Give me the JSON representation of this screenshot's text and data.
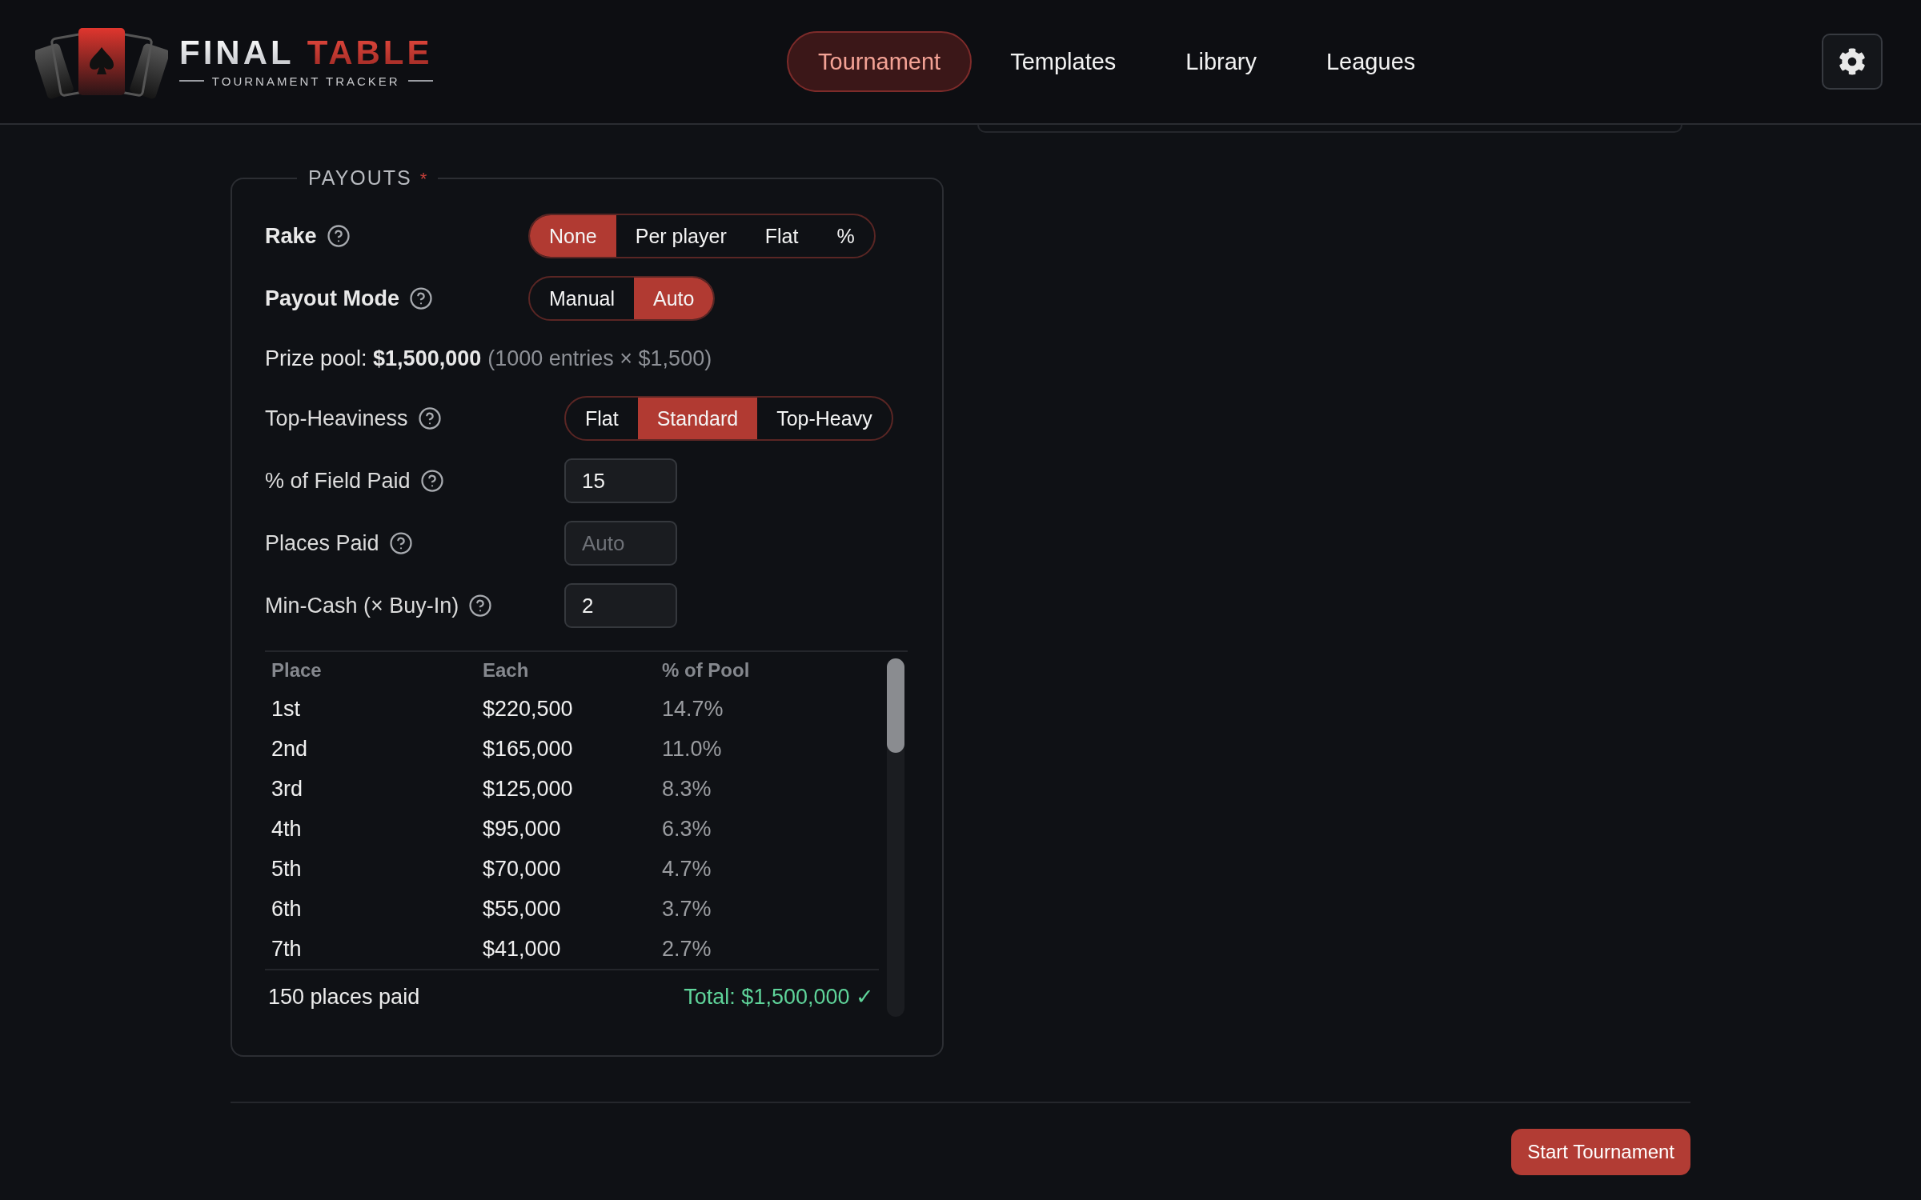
{
  "header": {
    "logo": {
      "title_primary": "FINAL",
      "title_accent": "TABLE",
      "subtitle": "TOURNAMENT TRACKER"
    },
    "nav": [
      {
        "label": "Tournament",
        "selected": true
      },
      {
        "label": "Templates",
        "selected": false
      },
      {
        "label": "Library",
        "selected": false
      },
      {
        "label": "Leagues",
        "selected": false
      }
    ]
  },
  "payouts": {
    "legend": "PAYOUTS",
    "required_mark": "*",
    "rows": [
      {
        "kind": "segmented",
        "label": "Rake",
        "strong": true,
        "options": [
          {
            "label": "None",
            "selected": true
          },
          {
            "label": "Per player",
            "selected": false
          },
          {
            "label": "Flat",
            "selected": false
          },
          {
            "label": "%",
            "selected": false
          }
        ]
      },
      {
        "kind": "segmented",
        "label": "Payout Mode",
        "strong": true,
        "options": [
          {
            "label": "Manual",
            "selected": false
          },
          {
            "label": "Auto",
            "selected": true
          }
        ]
      },
      {
        "kind": "summary",
        "text": "Prize pool: **$1,500,000**",
        "note": "(1000 entries × $1,500)"
      },
      {
        "kind": "segmented",
        "label": "Top-Heaviness",
        "strong": false,
        "options": [
          {
            "label": "Flat",
            "selected": false
          },
          {
            "label": "Standard",
            "selected": true
          },
          {
            "label": "Top-Heavy",
            "selected": false
          }
        ]
      },
      {
        "kind": "input",
        "label": "% of Field Paid",
        "strong": false,
        "value": "15"
      },
      {
        "kind": "input",
        "label": "Places Paid",
        "strong": false,
        "placeholder": "Auto"
      },
      {
        "kind": "input",
        "label": "Min-Cash (× Buy-In)",
        "strong": false,
        "value": "2"
      }
    ],
    "table": {
      "columns": [
        "Place",
        "Each",
        "% of Pool"
      ],
      "rows": [
        [
          "1st",
          "$220,500",
          "14.7%"
        ],
        [
          "2nd",
          "$165,000",
          "11.0%"
        ],
        [
          "3rd",
          "$125,000",
          "8.3%"
        ],
        [
          "4th",
          "$95,000",
          "6.3%"
        ],
        [
          "5th",
          "$70,000",
          "4.7%"
        ],
        [
          "6th",
          "$55,000",
          "3.7%"
        ],
        [
          "7th",
          "$41,000",
          "2.7%"
        ]
      ],
      "footer": {
        "count": "150 places paid",
        "total": "Total: $1,500,000 ✓"
      }
    }
  },
  "actions": {
    "start": "Start Tournament"
  }
}
